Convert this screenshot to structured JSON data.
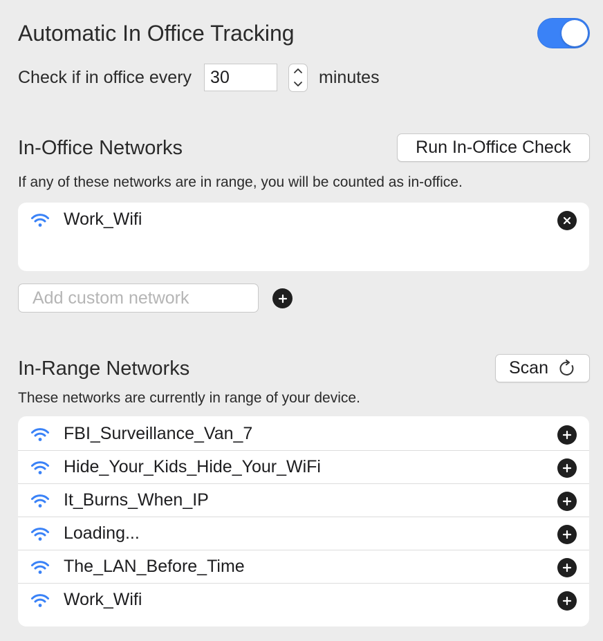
{
  "tracking": {
    "title": "Automatic In Office Tracking",
    "enabled": true,
    "interval_label": "Check if in office every",
    "interval_value": "30",
    "interval_unit": "minutes"
  },
  "office_networks": {
    "title": "In-Office Networks",
    "run_check_label": "Run In-Office Check",
    "description": "If any of these networks are in range, you will be counted as in-office.",
    "items": [
      {
        "name": "Work_Wifi"
      }
    ],
    "custom_placeholder": "Add custom network"
  },
  "range_networks": {
    "title": "In-Range Networks",
    "scan_label": "Scan",
    "description": "These networks are currently in range of your device.",
    "items": [
      {
        "name": "FBI_Surveillance_Van_7"
      },
      {
        "name": "Hide_Your_Kids_Hide_Your_WiFi"
      },
      {
        "name": "It_Burns_When_IP"
      },
      {
        "name": "Loading..."
      },
      {
        "name": "The_LAN_Before_Time"
      },
      {
        "name": "Work_Wifi"
      }
    ]
  },
  "icons": {
    "wifi": "wifi-icon",
    "remove": "close-icon",
    "add": "plus-icon",
    "scan": "refresh-icon",
    "stepper_up": "chevron-up-icon",
    "stepper_down": "chevron-down-icon"
  },
  "colors": {
    "accent": "#3a82f7",
    "background": "#ececec",
    "wifi": "#3a82f7"
  }
}
